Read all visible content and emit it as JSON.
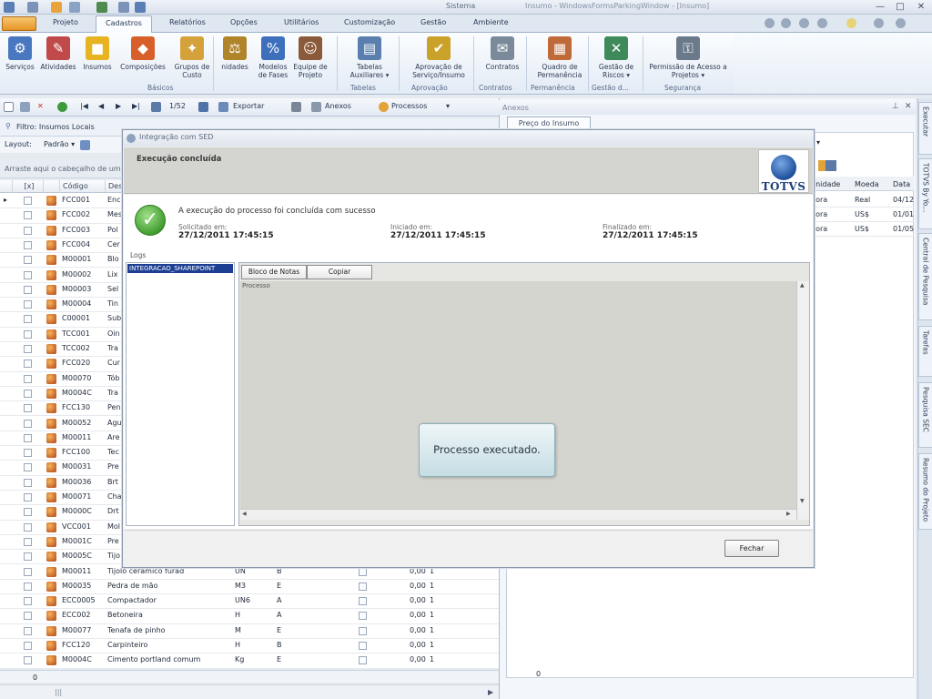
{
  "window": {
    "title": "Sistema",
    "subtitle": "Insumo - WindowsFormsParkingWindow - [Insumo]",
    "controls": [
      "—",
      "□",
      "✕"
    ]
  },
  "ribbon": {
    "tabs": [
      "Projeto",
      "Cadastros",
      "Relatórios",
      "Opções",
      "Utilitários",
      "Customização",
      "Gestão",
      "Ambiente"
    ],
    "active_tab": "Cadastros",
    "buttons": [
      {
        "label": "Serviços",
        "icon": "services-icon",
        "glyph": "⚙",
        "color": "#4a78c0"
      },
      {
        "label": "Atividades",
        "icon": "activities-icon",
        "glyph": "✎",
        "color": "#c04a4a"
      },
      {
        "label": "Insumos",
        "icon": "supplies-icon",
        "glyph": "■",
        "color": "#e8b320"
      },
      {
        "label": "Composições",
        "icon": "compositions-icon",
        "glyph": "◆",
        "color": "#d95f2a"
      },
      {
        "label": "Grupos de Custo",
        "icon": "cost-groups-icon",
        "glyph": "✦",
        "color": "#d4a13a"
      },
      {
        "label": "nidades",
        "icon": "units-icon",
        "glyph": "⚖",
        "color": "#b0852a"
      },
      {
        "label": "Modelos de Fases",
        "icon": "phase-models-icon",
        "glyph": "%",
        "color": "#3d6fbd"
      },
      {
        "label": "Equipe de Projeto",
        "icon": "project-team-icon",
        "glyph": "☺",
        "color": "#8a5a3a"
      },
      {
        "label": "Tabelas Auxiliares ▾",
        "icon": "aux-tables-icon",
        "glyph": "▤",
        "color": "#5a7fae"
      },
      {
        "label": "Aprovação de Serviço/Insumo",
        "icon": "approval-icon",
        "glyph": "✔",
        "color": "#caa22a"
      },
      {
        "label": "Contratos",
        "icon": "contracts-icon",
        "glyph": "✉",
        "color": "#7a8a9a"
      },
      {
        "label": "Quadro de Permanência",
        "icon": "permanence-board-icon",
        "glyph": "▦",
        "color": "#c06a3a"
      },
      {
        "label": "Gestão de Riscos ▾",
        "icon": "risk-mgmt-icon",
        "glyph": "✕",
        "color": "#3f8a5a"
      },
      {
        "label": "Permissão de Acesso a Projetos ▾",
        "icon": "access-permission-icon",
        "glyph": "⚿",
        "color": "#6a7a8a"
      }
    ],
    "groups": [
      "Básicos",
      "Tabelas",
      "Aprovação",
      "Contratos",
      "Permanência",
      "Gestão d...",
      "Segurança"
    ]
  },
  "toolbar": {
    "pager": "1/52",
    "export_label": "Exportar",
    "attachments_label": "Anexos",
    "processes_label": "Processos"
  },
  "filter": {
    "label": "Filtro: Insumos Locais",
    "layout_label": "Layout:",
    "layout_value": "Padrão ▾"
  },
  "grid": {
    "group_hint": "Arraste aqui o cabeçalho de ume",
    "headers": [
      "[x]",
      "Código",
      "Des"
    ],
    "rows": [
      {
        "code": "FCC001",
        "desc": "Enc",
        "unit": "",
        "cls": "",
        "val": ""
      },
      {
        "code": "FCC002",
        "desc": "Mes",
        "unit": "",
        "cls": "",
        "val": ""
      },
      {
        "code": "FCC003",
        "desc": "Pol",
        "unit": "",
        "cls": "",
        "val": ""
      },
      {
        "code": "FCC004",
        "desc": "Cer",
        "unit": "",
        "cls": "",
        "val": ""
      },
      {
        "code": "M00001",
        "desc": "Blo",
        "unit": "",
        "cls": "",
        "val": ""
      },
      {
        "code": "M00002",
        "desc": "Lix",
        "unit": "",
        "cls": "",
        "val": ""
      },
      {
        "code": "M00003",
        "desc": "Sel",
        "unit": "",
        "cls": "",
        "val": ""
      },
      {
        "code": "M00004",
        "desc": "Tin",
        "unit": "",
        "cls": "",
        "val": ""
      },
      {
        "code": "C00001",
        "desc": "Sub",
        "unit": "",
        "cls": "",
        "val": ""
      },
      {
        "code": "TCC001",
        "desc": "Oin",
        "unit": "",
        "cls": "",
        "val": ""
      },
      {
        "code": "TCC002",
        "desc": "Tra",
        "unit": "",
        "cls": "",
        "val": ""
      },
      {
        "code": "FCC020",
        "desc": "Cur",
        "unit": "",
        "cls": "",
        "val": ""
      },
      {
        "code": "M00070",
        "desc": "Tób",
        "unit": "",
        "cls": "",
        "val": ""
      },
      {
        "code": "M0004C",
        "desc": "Tra",
        "unit": "",
        "cls": "",
        "val": ""
      },
      {
        "code": "FCC130",
        "desc": "Pen",
        "unit": "",
        "cls": "",
        "val": ""
      },
      {
        "code": "M00052",
        "desc": "Agu",
        "unit": "",
        "cls": "",
        "val": ""
      },
      {
        "code": "M00011",
        "desc": "Are",
        "unit": "",
        "cls": "",
        "val": ""
      },
      {
        "code": "FCC100",
        "desc": "Tec",
        "unit": "",
        "cls": "",
        "val": ""
      },
      {
        "code": "M00031",
        "desc": "Pre",
        "unit": "",
        "cls": "",
        "val": ""
      },
      {
        "code": "M00036",
        "desc": "Brt",
        "unit": "",
        "cls": "",
        "val": ""
      },
      {
        "code": "M00071",
        "desc": "Cha",
        "unit": "",
        "cls": "",
        "val": ""
      },
      {
        "code": "M0000C",
        "desc": "Drt",
        "unit": "",
        "cls": "",
        "val": ""
      },
      {
        "code": "VCC001",
        "desc": "Mol",
        "unit": "",
        "cls": "",
        "val": ""
      },
      {
        "code": "M0001C",
        "desc": "Pre",
        "unit": "",
        "cls": "",
        "val": ""
      },
      {
        "code": "M0005C",
        "desc": "Tijo",
        "unit": "",
        "cls": "",
        "val": ""
      },
      {
        "code": "M00011",
        "desc": "Tijolo cerâmico furad",
        "unit": "UN",
        "cls": "B",
        "val": "0,00"
      },
      {
        "code": "M00035",
        "desc": "Pedra de mão",
        "unit": "M3",
        "cls": "E",
        "val": "0,00"
      },
      {
        "code": "ECC0005",
        "desc": "Compactador",
        "unit": "UN6",
        "cls": "A",
        "val": "0,00"
      },
      {
        "code": "ECC002",
        "desc": "Betoneira",
        "unit": "H",
        "cls": "A",
        "val": "0,00"
      },
      {
        "code": "M00077",
        "desc": "Tenafa de pinho",
        "unit": "M",
        "cls": "E",
        "val": "0,00"
      },
      {
        "code": "FCC120",
        "desc": "Carpinteiro",
        "unit": "H",
        "cls": "B",
        "val": "0,00"
      },
      {
        "code": "M0004C",
        "desc": "Cimento portland comum",
        "unit": "Kg",
        "cls": "E",
        "val": "0,00"
      }
    ],
    "footer_count": "0"
  },
  "right_pane": {
    "header": "Anexos",
    "tab": "Preço do Insumo",
    "headers": [
      "unidade",
      "Moeda",
      "Data"
    ],
    "rows": [
      [
        "hora",
        "Real",
        "04/12"
      ],
      [
        "hora",
        "US$",
        "01/01"
      ],
      [
        "hora",
        "US$",
        "01/05"
      ]
    ],
    "footer_count": "0"
  },
  "side_dock": [
    "Executar",
    "TOTVS By Yo...",
    "Central de Pesquisa",
    "Tarefas",
    "Pesquisa SEC",
    "Resumo do Projeto"
  ],
  "dialog": {
    "title": "Integração com SED",
    "banner_title": "Execução concluída",
    "logo_text": "TOTVS",
    "success_message": "A execução do processo foi concluída com sucesso",
    "requested_label": "Solicitado em:",
    "requested_value": "27/12/2011 17:45:15",
    "started_label": "Iniciado em:",
    "started_value": "27/12/2011 17:45:15",
    "finished_label": "Finalizado em:",
    "finished_value": "27/12/2011 17:45:15",
    "logs_label": "Logs",
    "logs_items": [
      "INTEGRACAO_SHAREPOINT"
    ],
    "notepad_button": "Bloco de Notas",
    "copy_button": "Copiar",
    "log_text": "Processo",
    "toast": "Processo executado.",
    "close_button": "Fechar"
  },
  "colors": {
    "selection": "#1c3f94",
    "accent_orange": "#e79426",
    "ribbon_blue": "#dfe7f1"
  }
}
